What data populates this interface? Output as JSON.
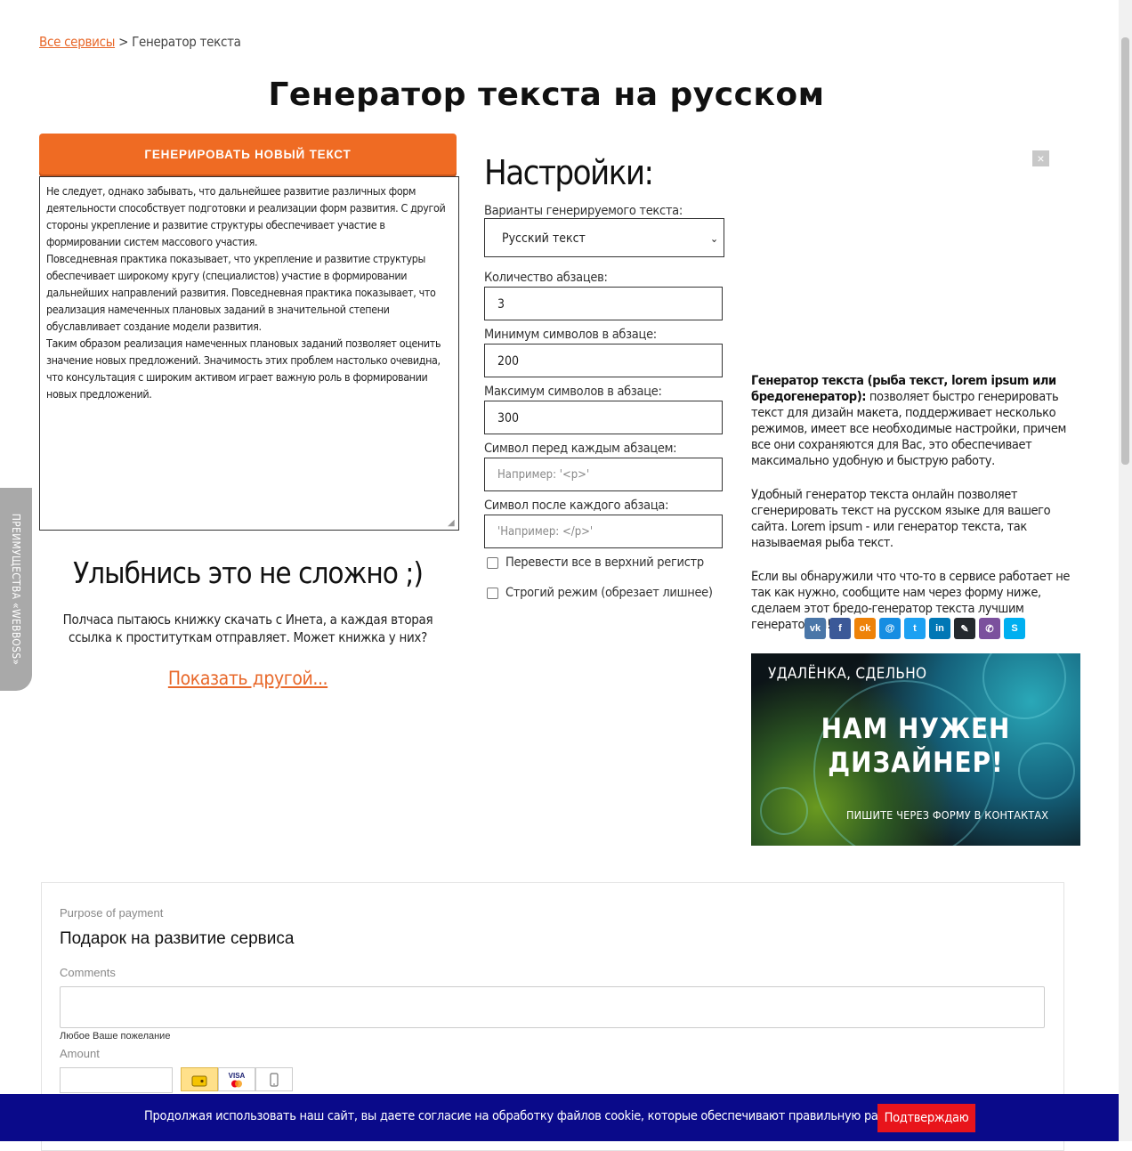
{
  "breadcrumb": {
    "home": "Все сервисы",
    "sep": ">",
    "current": "Генератор текста"
  },
  "title": "Генератор текста на русском",
  "generate_button": "Генерировать новый текст",
  "output_paragraphs": [
    "Не следует, однако забывать, что дальнейшее развитие различных форм деятельности способствует подготовки и реализации форм развития. С другой стороны укрепление и развитие структуры обеспечивает участие в формировании систем массового участия.",
    "Повседневная практика показывает, что укрепление и развитие структуры обеспечивает широкому кругу (специалистов) участие в формировании дальнейших направлений развития. Повседневная практика показывает, что реализация намеченных плановых заданий в значительной степени обуславливает создание модели развития.",
    "Таким образом реализация намеченных плановых заданий позволяет оценить значение новых предложений. Значимость этих проблем настолько очевидна, что консультация с широким активом играет важную роль в формировании новых предложений."
  ],
  "smile": {
    "title": "Улыбнись это не сложно ;)",
    "joke": "Полчаса пытаюсь книжку скачать с Инета, а каждая вторая ссылка к проституткам отправляет. Может книжка у них?",
    "show_another": "Показать другой..."
  },
  "side_tab": "ПРЕИМУЩЕСТВА «WEBBOSS»",
  "settings": {
    "title": "Настройки:",
    "variant_label": "Варианты генерируемого текста:",
    "variant_value": "Русский текст",
    "paragraphs_label": "Количество абзацев:",
    "paragraphs_value": "3",
    "min_label": "Минимум символов в абзаце:",
    "min_value": "200",
    "max_label": "Максимум символов в абзаце:",
    "max_value": "300",
    "before_label": "Символ перед каждым абзацем:",
    "before_placeholder": "Например: '<p>'",
    "after_label": "Символ после каждого абзаца:",
    "after_placeholder": "'Например: </p>'",
    "uppercase_label": "Перевести все в верхний регистр",
    "strict_label": "Строгий режим (обрезает лишнее)"
  },
  "about": {
    "lead_bold": "Генератор текста (рыба текст, lorem ipsum или бредогенератор):",
    "lead_rest": " позволяет быстро генерировать текст для дизайн макета, поддерживает несколько режимов, имеет все необходимые настройки, причем все они сохраняются для Вас, это обеспечивает максимально удобную и быструю работу.",
    "p2": "Удобный генератор текста онлайн позволяет сгенерировать текст на русском языке для вашего сайта. Lorem ipsum - или генератор текста, так называемая рыба текст.",
    "p3": "Если вы обнаружили что что-то в сервисе работает не так как нужно, сообщите нам через форму ниже, сделаем этот бредо-генератор текста лучшим генератором!!!"
  },
  "close_icon": "×",
  "share_icons": [
    {
      "name": "vk-icon",
      "glyph": "vk",
      "color": "#4a76a8"
    },
    {
      "name": "facebook-icon",
      "glyph": "f",
      "color": "#3b5998"
    },
    {
      "name": "odnoklassniki-icon",
      "glyph": "ok",
      "color": "#ee8208"
    },
    {
      "name": "moimir-icon",
      "glyph": "@",
      "color": "#168de2"
    },
    {
      "name": "twitter-icon",
      "glyph": "t",
      "color": "#1da1f2"
    },
    {
      "name": "linkedin-icon",
      "glyph": "in",
      "color": "#0077b5"
    },
    {
      "name": "evernote-icon",
      "glyph": "✎",
      "color": "#24292e"
    },
    {
      "name": "viber-icon",
      "glyph": "✆",
      "color": "#7b519d"
    },
    {
      "name": "skype-icon",
      "glyph": "S",
      "color": "#00aff0"
    }
  ],
  "banner": {
    "top": "УДАЛЁНКА, СДЕЛЬНО",
    "line1": "НАМ НУЖЕН",
    "line2": "ДИЗАЙНЕР!",
    "bottom": "ПИШИТЕ ЧЕРЕЗ ФОРМУ В КОНТАКТАХ"
  },
  "payment": {
    "purpose_label": "Purpose of payment",
    "purpose_value": "Подарок на развитие сервиса",
    "comments_label": "Comments",
    "hint": "Любое Ваше пожелание",
    "amount_label": "Amount",
    "card_label": "VISA"
  },
  "cookie": {
    "text": "Продолжая использовать наш сайт, вы даете согласие на обработку файлов cookie, которые обеспечивают правильную работу сайта.",
    "button": "Подтверждаю"
  }
}
